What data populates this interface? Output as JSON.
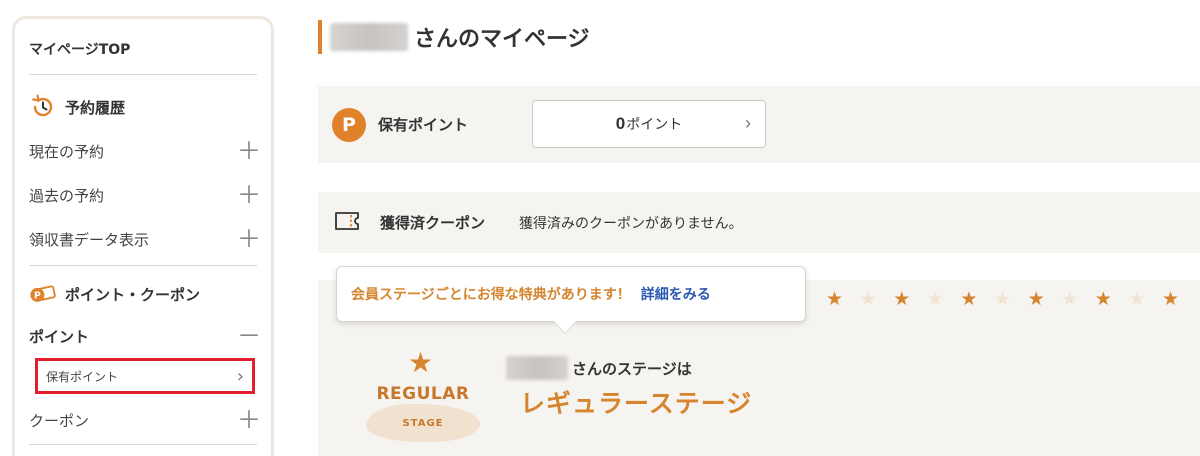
{
  "sidebar": {
    "top_label": "マイページTOP",
    "history": {
      "heading": "予約履歴",
      "icon": "history-clock-icon",
      "items": [
        {
          "label": "現在の予約",
          "toggle": "＋"
        },
        {
          "label": "過去の予約",
          "toggle": "＋"
        },
        {
          "label": "領収書データ表示",
          "toggle": "＋"
        }
      ]
    },
    "points_coupons": {
      "heading": "ポイント・クーポン",
      "icon": "point-coupon-icon",
      "points_item": {
        "label": "ポイント",
        "toggle": "－"
      },
      "points_sub": {
        "label": "保有ポイント",
        "chevron": "›"
      },
      "coupon_item": {
        "label": "クーポン",
        "toggle": "＋"
      }
    }
  },
  "header": {
    "title_suffix": "さんのマイページ"
  },
  "points_panel": {
    "icon_letter": "P",
    "label": "保有ポイント",
    "value": "0",
    "unit": "ポイント",
    "chevron": "›"
  },
  "coupon_panel": {
    "label": "獲得済クーポン",
    "message": "獲得済みのクーポンがありません。"
  },
  "stage_panel": {
    "tooltip_text": "会員ステージごとにお得な特典があります！",
    "tooltip_link": "詳細をみる",
    "badge_regular": "REGULAR",
    "badge_stage": "STAGE",
    "stage_prefix": "さんのステージは",
    "stage_name": "レギュラーステージ",
    "star_glyph": "★"
  },
  "colors": {
    "accent": "#e0822a",
    "star": "#d5852e",
    "link": "#2a57b0",
    "highlight_box": "#e11f2d",
    "panel_bg": "#f6f4f1"
  }
}
